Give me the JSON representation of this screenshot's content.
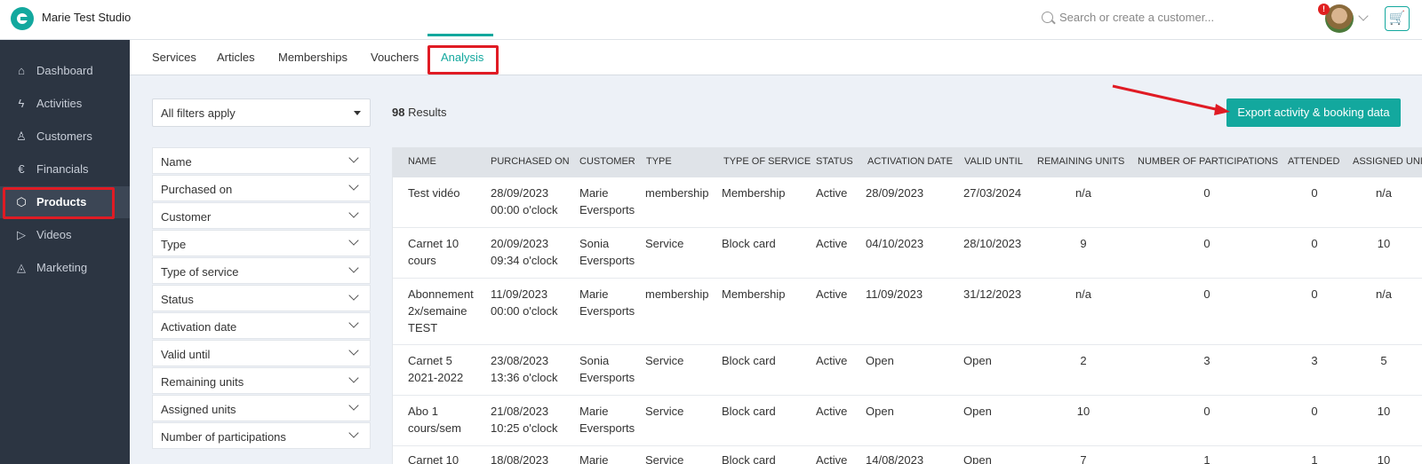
{
  "app": {
    "studio_name": "Marie Test Studio",
    "search_placeholder": "Search or create a customer...",
    "notification_badge": "!",
    "cart_glyph": "🛒",
    "accent_color": "#13a89e"
  },
  "sidebar": {
    "items": [
      {
        "label": "Dashboard",
        "icon": "home-icon"
      },
      {
        "label": "Activities",
        "icon": "bolt-icon"
      },
      {
        "label": "Customers",
        "icon": "user-icon"
      },
      {
        "label": "Financials",
        "icon": "euro-icon"
      },
      {
        "label": "Products",
        "icon": "box-icon"
      },
      {
        "label": "Videos",
        "icon": "play-icon"
      },
      {
        "label": "Marketing",
        "icon": "megaphone-icon"
      }
    ],
    "active": "Products"
  },
  "tabs": {
    "items": [
      "Services",
      "Articles",
      "Memberships",
      "Vouchers",
      "Analysis"
    ],
    "active": "Analysis"
  },
  "toolbar": {
    "filter_select": "All filters apply",
    "results_count": "98",
    "results_label": "Results",
    "export_label": "Export activity & booking data"
  },
  "filters": [
    "Name",
    "Purchased on",
    "Customer",
    "Type",
    "Type of service",
    "Status",
    "Activation date",
    "Valid until",
    "Remaining units",
    "Assigned units",
    "Number of participations"
  ],
  "table": {
    "columns": [
      "NAME",
      "PURCHASED ON",
      "CUSTOMER",
      "TYPE",
      "TYPE OF SERVICE",
      "STATUS",
      "ACTIVATION DATE",
      "VALID UNTIL",
      "REMAINING UNITS",
      "NUMBER OF PARTICIPATIONS",
      "ATTENDED",
      "ASSIGNED UNITS"
    ],
    "rows": [
      {
        "name": "Test vidéo",
        "purchased": "28/09/2023\n00:00 o'clock",
        "customer": "Marie\nEversports",
        "type": "membership",
        "service": "Membership",
        "status": "Active",
        "activation": "28/09/2023",
        "valid": "27/03/2024",
        "remaining": "n/a",
        "participations": "0",
        "attended": "0",
        "assigned": "n/a"
      },
      {
        "name": "Carnet 10\ncours",
        "purchased": "20/09/2023\n09:34 o'clock",
        "customer": "Sonia\nEversports",
        "type": "Service",
        "service": "Block card",
        "status": "Active",
        "activation": "04/10/2023",
        "valid": "28/10/2023",
        "remaining": "9",
        "participations": "0",
        "attended": "0",
        "assigned": "10"
      },
      {
        "name": "Abonnement\n2x/semaine\nTEST",
        "purchased": "11/09/2023\n00:00 o'clock",
        "customer": "Marie\nEversports",
        "type": "membership",
        "service": "Membership",
        "status": "Active",
        "activation": "11/09/2023",
        "valid": "31/12/2023",
        "remaining": "n/a",
        "participations": "0",
        "attended": "0",
        "assigned": "n/a"
      },
      {
        "name": "Carnet 5\n2021-2022",
        "purchased": "23/08/2023\n13:36 o'clock",
        "customer": "Sonia\nEversports",
        "type": "Service",
        "service": "Block card",
        "status": "Active",
        "activation": "Open",
        "valid": "Open",
        "remaining": "2",
        "participations": "3",
        "attended": "3",
        "assigned": "5"
      },
      {
        "name": "Abo 1\ncours/sem",
        "purchased": "21/08/2023\n10:25 o'clock",
        "customer": "Marie\nEversports",
        "type": "Service",
        "service": "Block card",
        "status": "Active",
        "activation": "Open",
        "valid": "Open",
        "remaining": "10",
        "participations": "0",
        "attended": "0",
        "assigned": "10"
      },
      {
        "name": "Carnet 10",
        "purchased": "18/08/2023",
        "customer": "Marie",
        "type": "Service",
        "service": "Block card",
        "status": "Active",
        "activation": "14/08/2023",
        "valid": "Open",
        "remaining": "7",
        "participations": "1",
        "attended": "1",
        "assigned": "10"
      }
    ]
  }
}
